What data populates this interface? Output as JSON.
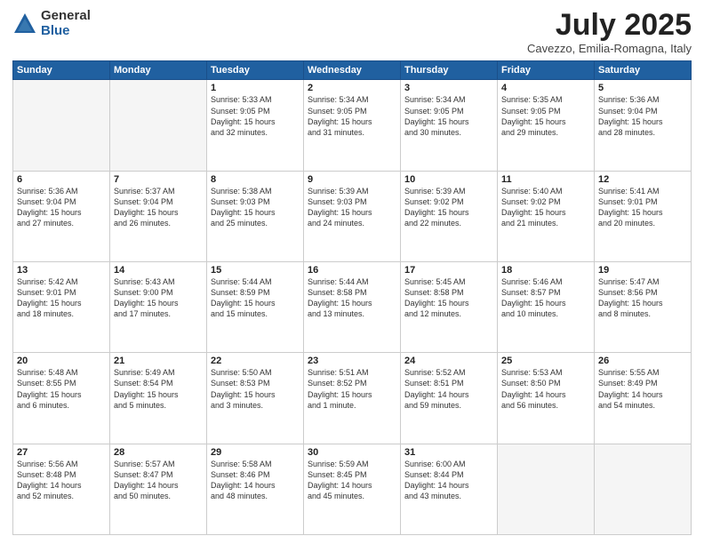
{
  "header": {
    "logo_general": "General",
    "logo_blue": "Blue",
    "month_title": "July 2025",
    "location": "Cavezzo, Emilia-Romagna, Italy"
  },
  "weekdays": [
    "Sunday",
    "Monday",
    "Tuesday",
    "Wednesday",
    "Thursday",
    "Friday",
    "Saturday"
  ],
  "weeks": [
    [
      {
        "day": "",
        "text": ""
      },
      {
        "day": "",
        "text": ""
      },
      {
        "day": "1",
        "text": "Sunrise: 5:33 AM\nSunset: 9:05 PM\nDaylight: 15 hours\nand 32 minutes."
      },
      {
        "day": "2",
        "text": "Sunrise: 5:34 AM\nSunset: 9:05 PM\nDaylight: 15 hours\nand 31 minutes."
      },
      {
        "day": "3",
        "text": "Sunrise: 5:34 AM\nSunset: 9:05 PM\nDaylight: 15 hours\nand 30 minutes."
      },
      {
        "day": "4",
        "text": "Sunrise: 5:35 AM\nSunset: 9:05 PM\nDaylight: 15 hours\nand 29 minutes."
      },
      {
        "day": "5",
        "text": "Sunrise: 5:36 AM\nSunset: 9:04 PM\nDaylight: 15 hours\nand 28 minutes."
      }
    ],
    [
      {
        "day": "6",
        "text": "Sunrise: 5:36 AM\nSunset: 9:04 PM\nDaylight: 15 hours\nand 27 minutes."
      },
      {
        "day": "7",
        "text": "Sunrise: 5:37 AM\nSunset: 9:04 PM\nDaylight: 15 hours\nand 26 minutes."
      },
      {
        "day": "8",
        "text": "Sunrise: 5:38 AM\nSunset: 9:03 PM\nDaylight: 15 hours\nand 25 minutes."
      },
      {
        "day": "9",
        "text": "Sunrise: 5:39 AM\nSunset: 9:03 PM\nDaylight: 15 hours\nand 24 minutes."
      },
      {
        "day": "10",
        "text": "Sunrise: 5:39 AM\nSunset: 9:02 PM\nDaylight: 15 hours\nand 22 minutes."
      },
      {
        "day": "11",
        "text": "Sunrise: 5:40 AM\nSunset: 9:02 PM\nDaylight: 15 hours\nand 21 minutes."
      },
      {
        "day": "12",
        "text": "Sunrise: 5:41 AM\nSunset: 9:01 PM\nDaylight: 15 hours\nand 20 minutes."
      }
    ],
    [
      {
        "day": "13",
        "text": "Sunrise: 5:42 AM\nSunset: 9:01 PM\nDaylight: 15 hours\nand 18 minutes."
      },
      {
        "day": "14",
        "text": "Sunrise: 5:43 AM\nSunset: 9:00 PM\nDaylight: 15 hours\nand 17 minutes."
      },
      {
        "day": "15",
        "text": "Sunrise: 5:44 AM\nSunset: 8:59 PM\nDaylight: 15 hours\nand 15 minutes."
      },
      {
        "day": "16",
        "text": "Sunrise: 5:44 AM\nSunset: 8:58 PM\nDaylight: 15 hours\nand 13 minutes."
      },
      {
        "day": "17",
        "text": "Sunrise: 5:45 AM\nSunset: 8:58 PM\nDaylight: 15 hours\nand 12 minutes."
      },
      {
        "day": "18",
        "text": "Sunrise: 5:46 AM\nSunset: 8:57 PM\nDaylight: 15 hours\nand 10 minutes."
      },
      {
        "day": "19",
        "text": "Sunrise: 5:47 AM\nSunset: 8:56 PM\nDaylight: 15 hours\nand 8 minutes."
      }
    ],
    [
      {
        "day": "20",
        "text": "Sunrise: 5:48 AM\nSunset: 8:55 PM\nDaylight: 15 hours\nand 6 minutes."
      },
      {
        "day": "21",
        "text": "Sunrise: 5:49 AM\nSunset: 8:54 PM\nDaylight: 15 hours\nand 5 minutes."
      },
      {
        "day": "22",
        "text": "Sunrise: 5:50 AM\nSunset: 8:53 PM\nDaylight: 15 hours\nand 3 minutes."
      },
      {
        "day": "23",
        "text": "Sunrise: 5:51 AM\nSunset: 8:52 PM\nDaylight: 15 hours\nand 1 minute."
      },
      {
        "day": "24",
        "text": "Sunrise: 5:52 AM\nSunset: 8:51 PM\nDaylight: 14 hours\nand 59 minutes."
      },
      {
        "day": "25",
        "text": "Sunrise: 5:53 AM\nSunset: 8:50 PM\nDaylight: 14 hours\nand 56 minutes."
      },
      {
        "day": "26",
        "text": "Sunrise: 5:55 AM\nSunset: 8:49 PM\nDaylight: 14 hours\nand 54 minutes."
      }
    ],
    [
      {
        "day": "27",
        "text": "Sunrise: 5:56 AM\nSunset: 8:48 PM\nDaylight: 14 hours\nand 52 minutes."
      },
      {
        "day": "28",
        "text": "Sunrise: 5:57 AM\nSunset: 8:47 PM\nDaylight: 14 hours\nand 50 minutes."
      },
      {
        "day": "29",
        "text": "Sunrise: 5:58 AM\nSunset: 8:46 PM\nDaylight: 14 hours\nand 48 minutes."
      },
      {
        "day": "30",
        "text": "Sunrise: 5:59 AM\nSunset: 8:45 PM\nDaylight: 14 hours\nand 45 minutes."
      },
      {
        "day": "31",
        "text": "Sunrise: 6:00 AM\nSunset: 8:44 PM\nDaylight: 14 hours\nand 43 minutes."
      },
      {
        "day": "",
        "text": ""
      },
      {
        "day": "",
        "text": ""
      }
    ]
  ]
}
